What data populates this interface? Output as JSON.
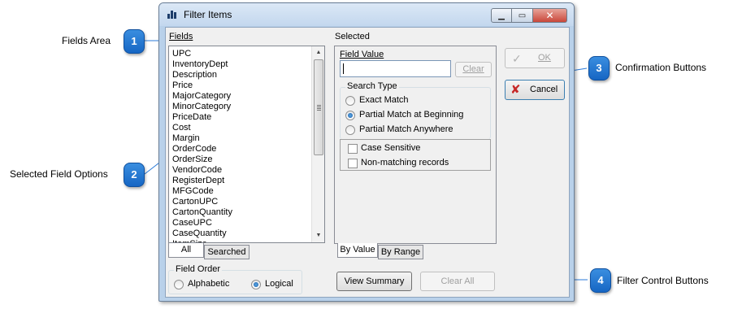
{
  "window": {
    "title": "Filter Items"
  },
  "fields": {
    "label": "Fields",
    "items": [
      "UPC",
      "InventoryDept",
      "Description",
      "Price",
      "MajorCategory",
      "MinorCategory",
      "PriceDate",
      "Cost",
      "Margin",
      "OrderCode",
      "OrderSize",
      "VendorCode",
      "RegisterDept",
      "MFGCode",
      "CartonUPC",
      "CartonQuantity",
      "CaseUPC",
      "CaseQuantity",
      "ItemSize"
    ],
    "tabs": [
      "All",
      "Searched"
    ],
    "active_tab": "All"
  },
  "field_order": {
    "title": "Field Order",
    "options": [
      "Alphabetic",
      "Logical"
    ],
    "selected": "Logical"
  },
  "selected": {
    "label": "Selected",
    "field_value_label": "Field Value",
    "field_value": "",
    "clear_button": "Clear",
    "search_type": {
      "title": "Search Type",
      "options": [
        "Exact Match",
        "Partial Match at Beginning",
        "Partial Match Anywhere"
      ],
      "selected": "Partial Match at Beginning"
    },
    "checkboxes": [
      "Case Sensitive",
      "Non-matching records"
    ],
    "tabs": [
      "By Value",
      "By Range"
    ],
    "active_tab": "By Value"
  },
  "buttons": {
    "ok": "OK",
    "cancel": "Cancel",
    "view_summary": "View Summary",
    "clear_all": "Clear All"
  },
  "callouts": [
    {
      "number": "1",
      "text": "Fields Area"
    },
    {
      "number": "2",
      "text": "Selected Field Options"
    },
    {
      "number": "3",
      "text": "Confirmation Buttons"
    },
    {
      "number": "4",
      "text": "Filter Control Buttons"
    }
  ],
  "colors": {
    "callout_blue": "#1f74d4",
    "window_frame": "#b9d1ea",
    "close_red": "#c9473a"
  }
}
